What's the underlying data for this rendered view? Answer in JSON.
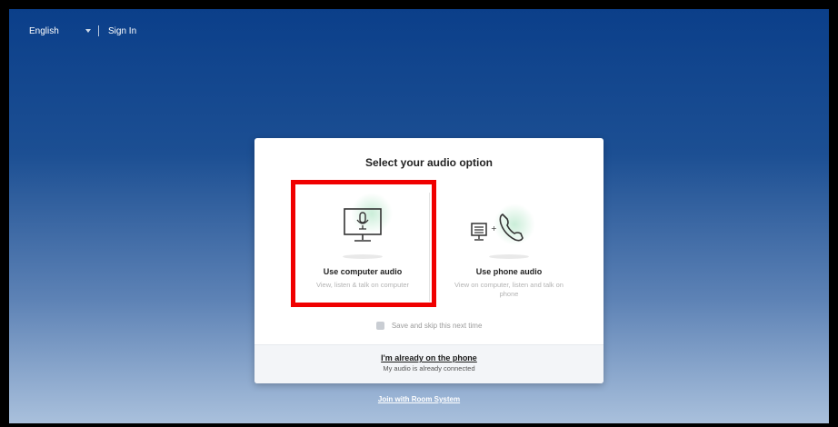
{
  "topbar": {
    "language": "English",
    "signin": "Sign In"
  },
  "modal": {
    "title": "Select your audio option",
    "options": [
      {
        "label": "Use computer audio",
        "desc": "View, listen & talk on computer",
        "icon": "monitor-microphone-icon"
      },
      {
        "label": "Use phone audio",
        "desc": "View on computer, listen and talk on phone",
        "icon": "phone-icon"
      }
    ],
    "skip_label": "Save and skip this next time",
    "already_link": "I'm already on the phone",
    "already_sub": "My audio is already connected"
  },
  "room_system_link": "Join with Room System",
  "colors": {
    "highlight": "#f00000",
    "accent_glow": "#b4e6c8"
  }
}
